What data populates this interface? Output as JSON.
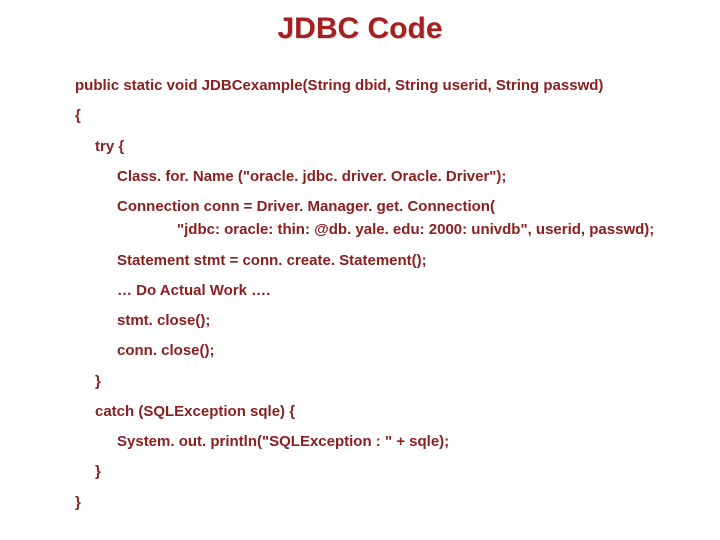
{
  "title": "JDBC Code",
  "code": {
    "l1": "public static void JDBCexample(String dbid, String userid, String passwd)",
    "l2": "{",
    "l3": "try {",
    "l4": "Class. for. Name (\"oracle. jdbc. driver. Oracle. Driver\");",
    "l5": "Connection conn = Driver. Manager. get. Connection(",
    "l6": "\"jdbc: oracle: thin: @db. yale. edu: 2000: univdb\", userid, passwd);",
    "l7": "Statement stmt = conn. create. Statement();",
    "l8": "… Do Actual Work ….",
    "l9": "stmt. close();",
    "l10": "conn. close();",
    "l11": "}",
    "l12": "catch (SQLException sqle) {",
    "l13": "System. out. println(\"SQLException : \" + sqle);",
    "l14": "}",
    "l15": "}"
  }
}
